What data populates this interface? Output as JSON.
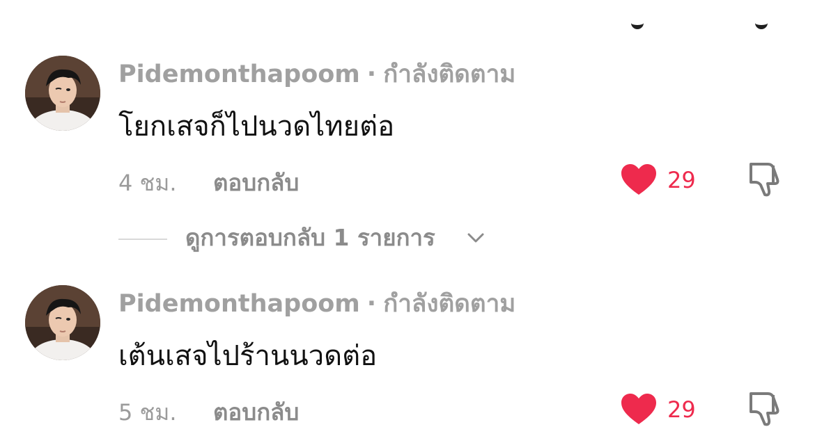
{
  "colors": {
    "like_red": "#ee2a4d",
    "muted_gray": "#8b8b8b",
    "text_dark": "#111111"
  },
  "comments": [
    {
      "username": "Pidemonthapoom",
      "separator": "·",
      "follow_status": "กำลังติดตาม",
      "text": "โยกเสจก็ไปนวดไทยต่อ",
      "time": "4 ชม.",
      "reply_label": "ตอบกลับ",
      "likes": "29",
      "like_icon": "heart-icon",
      "dislike_icon": "thumbs-down-icon",
      "view_replies": "ดูการตอบกลับ 1 รายการ"
    },
    {
      "username": "Pidemonthapoom",
      "separator": "·",
      "follow_status": "กำลังติดตาม",
      "text": "เต้นเสจไปร้านนวดต่อ",
      "time": "5 ชม.",
      "reply_label": "ตอบกลับ",
      "likes": "29",
      "like_icon": "heart-icon",
      "dislike_icon": "thumbs-down-icon"
    }
  ]
}
